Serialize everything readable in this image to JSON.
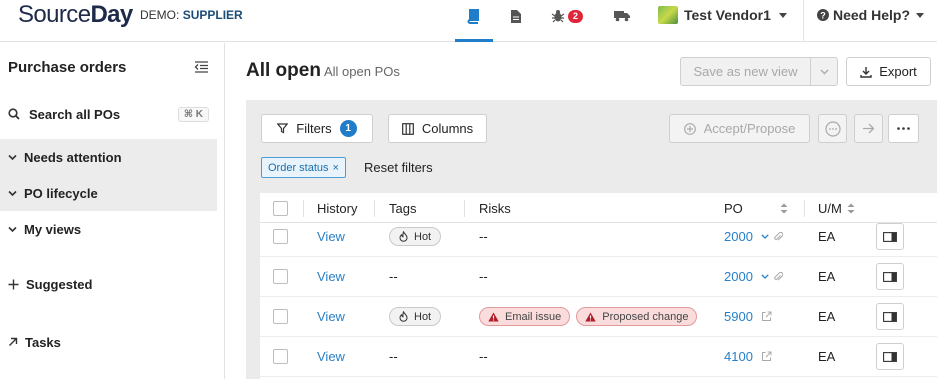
{
  "header": {
    "logo": {
      "part1": "Source",
      "part2": "Day"
    },
    "demo_label": "DEMO:",
    "demo_role": "SUPPLIER",
    "nav_icons": [
      "book-icon",
      "document-icon",
      "bug-icon",
      "truck-icon"
    ],
    "bug_badge": "2",
    "vendor_name": "Test Vendor1",
    "help_label": "Need Help?",
    "accent_color": "#1f7dc9",
    "badge_color": "#e0263a"
  },
  "sidebar": {
    "title": "Purchase orders",
    "search_label": "Search all POs",
    "search_shortcut": "⌘ K",
    "items": [
      {
        "label": "Needs attention"
      },
      {
        "label": "PO lifecycle"
      },
      {
        "label": "My views"
      },
      {
        "label": "Suggested"
      },
      {
        "label": "Tasks"
      }
    ]
  },
  "main": {
    "title": "All open",
    "subtitle": "All open POs",
    "save_view_label": "Save as new view",
    "export_label": "Export",
    "filters_label": "Filters",
    "filters_count": "1",
    "columns_label": "Columns",
    "accept_label": "Accept/Propose",
    "chip_label": "Order status",
    "chip_remove": "×",
    "reset_label": "Reset filters"
  },
  "table": {
    "headers": {
      "history": "History",
      "tags": "Tags",
      "risks": "Risks",
      "po": "PO",
      "um": "U/M"
    },
    "rows": [
      {
        "history": "View",
        "tag": "Hot",
        "risks": "--",
        "po": "2000",
        "po_icons": "chevron-paperclip",
        "um": "EA"
      },
      {
        "history": "View",
        "tag": "--",
        "risks": "--",
        "po": "2000",
        "po_icons": "chevron-paperclip",
        "um": "EA"
      },
      {
        "history": "View",
        "tag": "Hot",
        "risk1": "Email issue",
        "risk2": "Proposed change",
        "po": "5900",
        "po_icons": "external-link",
        "um": "EA"
      },
      {
        "history": "View",
        "tag": "--",
        "risks": "--",
        "po": "4100",
        "po_icons": "external-link",
        "um": "EA"
      }
    ]
  }
}
